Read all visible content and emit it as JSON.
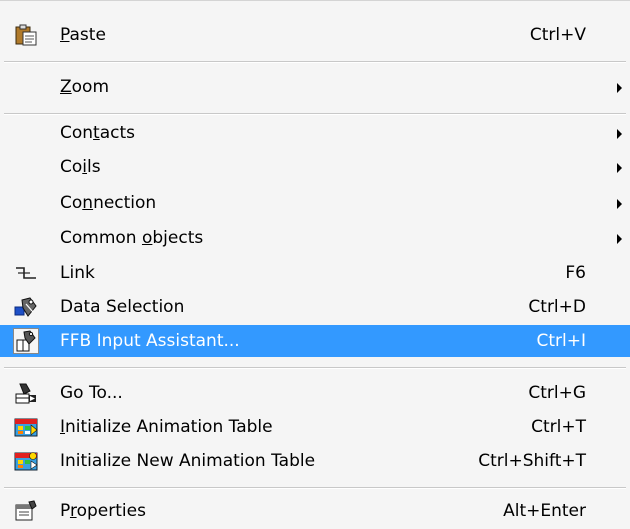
{
  "menu": {
    "paste": {
      "label": "Paste",
      "mnemonic_index": 0,
      "shortcut": "Ctrl+V",
      "icon": "clipboard-icon"
    },
    "zoom": {
      "label": "Zoom",
      "mnemonic_index": 0
    },
    "contacts": {
      "label": "Contacts",
      "mnemonic_index": 3
    },
    "coils": {
      "label": "Coils",
      "mnemonic_index": 2
    },
    "connection": {
      "label": "Connection",
      "mnemonic_index": 2
    },
    "common_objects": {
      "label": "Common objects",
      "mnemonic_index": 7
    },
    "link": {
      "label": "Link",
      "shortcut": "F6",
      "icon": "link-icon"
    },
    "data_selection": {
      "label": "Data Selection",
      "shortcut": "Ctrl+D",
      "icon": "data-selection-icon"
    },
    "ffb_input": {
      "label": "FFB Input Assistant...",
      "shortcut": "Ctrl+I",
      "icon": "ffb-input-icon",
      "highlighted": true
    },
    "go_to": {
      "label": "Go To...",
      "shortcut": "Ctrl+G",
      "icon": "go-to-icon"
    },
    "init_anim": {
      "label": "Initialize Animation Table",
      "mnemonic_index": 0,
      "shortcut": "Ctrl+T",
      "icon": "animation-table-icon"
    },
    "init_new_anim": {
      "label": "Initialize New Animation Table",
      "shortcut": "Ctrl+Shift+T",
      "icon": "new-animation-table-icon"
    },
    "properties": {
      "label": "Properties",
      "mnemonic_index": 1,
      "shortcut": "Alt+Enter",
      "icon": "properties-icon"
    }
  },
  "colors": {
    "highlight": "#3399ff",
    "menu_bg": "#f5f5f5"
  }
}
